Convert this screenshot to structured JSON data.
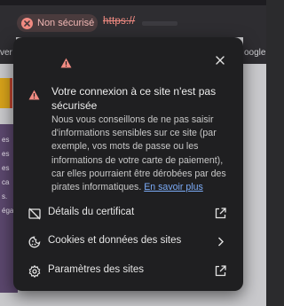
{
  "chrome": {
    "security_chip_label": "Non sécurisé",
    "url_prefix": "https://",
    "bookmark_left": "ver",
    "bookmark_right": "oogle",
    "page_left_lines": [
      "es",
      "es",
      "es",
      "ca",
      "s.",
      "égal"
    ]
  },
  "popup": {
    "title": "Votre connexion à ce site n'est pas sécurisée",
    "description": "Nous vous conseillons de ne pas saisir d'informations sensibles sur ce site (par exemple, vos mots de passe ou les informations de votre carte de paiement), car elles pourraient être dérobées par des pirates informatiques.",
    "learn_more": "En savoir plus",
    "rows": [
      {
        "label": "Détails du certificat",
        "icon": "certificate-icon",
        "trailing": "open-in-new-icon"
      },
      {
        "label": "Cookies et données des sites",
        "icon": "cookie-icon",
        "trailing": "chevron-right-icon"
      },
      {
        "label": "Paramètres des sites",
        "icon": "gear-icon",
        "trailing": "open-in-new-icon"
      }
    ]
  },
  "colors": {
    "warning_red": "#f28b82",
    "link_blue": "#7cacf8",
    "popup_bg": "#1f1f21"
  }
}
